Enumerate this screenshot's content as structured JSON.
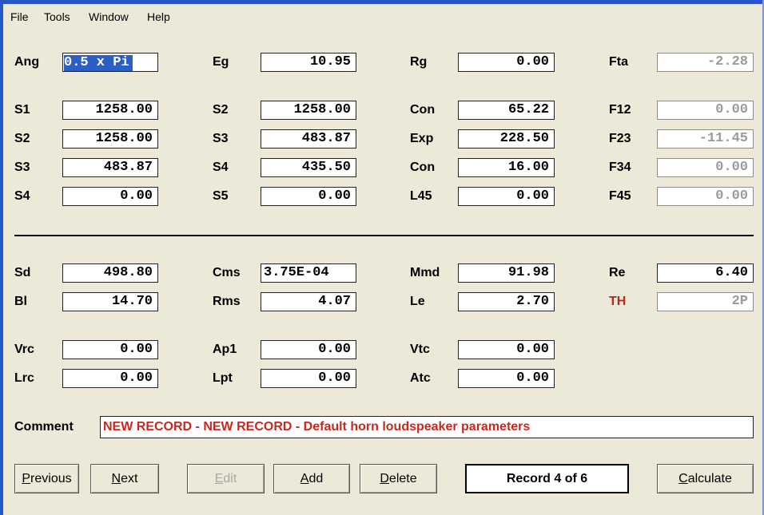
{
  "menu": {
    "file": "File",
    "tools": "Tools",
    "window": "Window",
    "help": "Help"
  },
  "rows": {
    "ang": {
      "l1": "Ang",
      "v1": "0.5 x Pi",
      "l2": "Eg",
      "v2": "10.95",
      "l3": "Rg",
      "v3": "0.00",
      "l4": "Fta",
      "v4": "-2.28"
    },
    "r1": {
      "l1": "S1",
      "v1": "1258.00",
      "l2": "S2",
      "v2": "1258.00",
      "l3": "Con",
      "v3": "65.22",
      "l4": "F12",
      "v4": "0.00"
    },
    "r2": {
      "l1": "S2",
      "v1": "1258.00",
      "l2": "S3",
      "v2": "483.87",
      "l3": "Exp",
      "v3": "228.50",
      "l4": "F23",
      "v4": "-11.45"
    },
    "r3": {
      "l1": "S3",
      "v1": "483.87",
      "l2": "S4",
      "v2": "435.50",
      "l3": "Con",
      "v3": "16.00",
      "l4": "F34",
      "v4": "0.00"
    },
    "r4": {
      "l1": "S4",
      "v1": "0.00",
      "l2": "S5",
      "v2": "0.00",
      "l3": "L45",
      "v3": "0.00",
      "l4": "F45",
      "v4": "0.00"
    },
    "d1": {
      "l1": "Sd",
      "v1": "498.80",
      "l2": "Cms",
      "v2": "3.75E-04",
      "l3": "Mmd",
      "v3": "91.98",
      "l4": "Re",
      "v4": "6.40"
    },
    "d2": {
      "l1": "Bl",
      "v1": "14.70",
      "l2": "Rms",
      "v2": "4.07",
      "l3": "Le",
      "v3": "2.70",
      "l4": "TH",
      "v4": "2P"
    },
    "e1": {
      "l1": "Vrc",
      "v1": "0.00",
      "l2": "Ap1",
      "v2": "0.00",
      "l3": "Vtc",
      "v3": "0.00"
    },
    "e2": {
      "l1": "Lrc",
      "v1": "0.00",
      "l2": "Lpt",
      "v2": "0.00",
      "l3": "Atc",
      "v3": "0.00"
    }
  },
  "comment": {
    "label": "Comment",
    "value": "NEW RECORD - NEW RECORD - Default horn loudspeaker parameters"
  },
  "buttons": {
    "previous": {
      "hotkey": "P",
      "rest": "revious"
    },
    "next": {
      "hotkey": "N",
      "rest": "ext"
    },
    "edit": {
      "hotkey": "E",
      "rest": "dit"
    },
    "add": {
      "hotkey": "A",
      "rest": "dd"
    },
    "delete": {
      "hotkey": "D",
      "rest": "elete"
    },
    "calculate": {
      "hotkey": "C",
      "rest": "alculate"
    }
  },
  "record_status": "Record 4 of 6",
  "colors": {
    "title_bar": "#2a55c8",
    "background": "#ece9d8",
    "comment_text": "#c8281e",
    "th_label": "#b22a1a",
    "selection": "#2c5fc4"
  }
}
